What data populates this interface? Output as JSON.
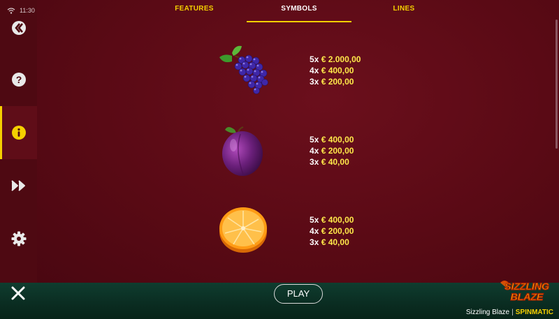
{
  "status": {
    "time": "11:30"
  },
  "tabs": [
    {
      "label": "FEATURES",
      "active": false
    },
    {
      "label": "SYMBOLS",
      "active": true
    },
    {
      "label": "LINES",
      "active": false
    }
  ],
  "sidebar": [
    {
      "icon": "back-icon"
    },
    {
      "icon": "help-icon"
    },
    {
      "icon": "info-icon",
      "active": true
    },
    {
      "icon": "fast-forward-icon"
    },
    {
      "icon": "settings-icon"
    }
  ],
  "symbols": [
    {
      "name": "grapes",
      "payouts": [
        {
          "mult": "5x",
          "amount": "€ 2.000,00"
        },
        {
          "mult": "4x",
          "amount": "€ 400,00"
        },
        {
          "mult": "3x",
          "amount": "€ 200,00"
        }
      ]
    },
    {
      "name": "plum",
      "payouts": [
        {
          "mult": "5x",
          "amount": "€ 400,00"
        },
        {
          "mult": "4x",
          "amount": "€ 200,00"
        },
        {
          "mult": "3x",
          "amount": "€ 40,00"
        }
      ]
    },
    {
      "name": "orange",
      "payouts": [
        {
          "mult": "5x",
          "amount": "€ 400,00"
        },
        {
          "mult": "4x",
          "amount": "€ 200,00"
        },
        {
          "mult": "3x",
          "amount": "€ 40,00"
        }
      ]
    }
  ],
  "bottom": {
    "play_label": "PLAY",
    "game_name": "Sizzling Blaze",
    "separator": "|",
    "studio": "SPINMATIC",
    "logo_text_1": "SIZZLING",
    "logo_text_2": "BLAZE"
  },
  "colors": {
    "accent": "#f5d000",
    "background": "#5a0a14",
    "bottom_bar": "#0a2c21"
  }
}
